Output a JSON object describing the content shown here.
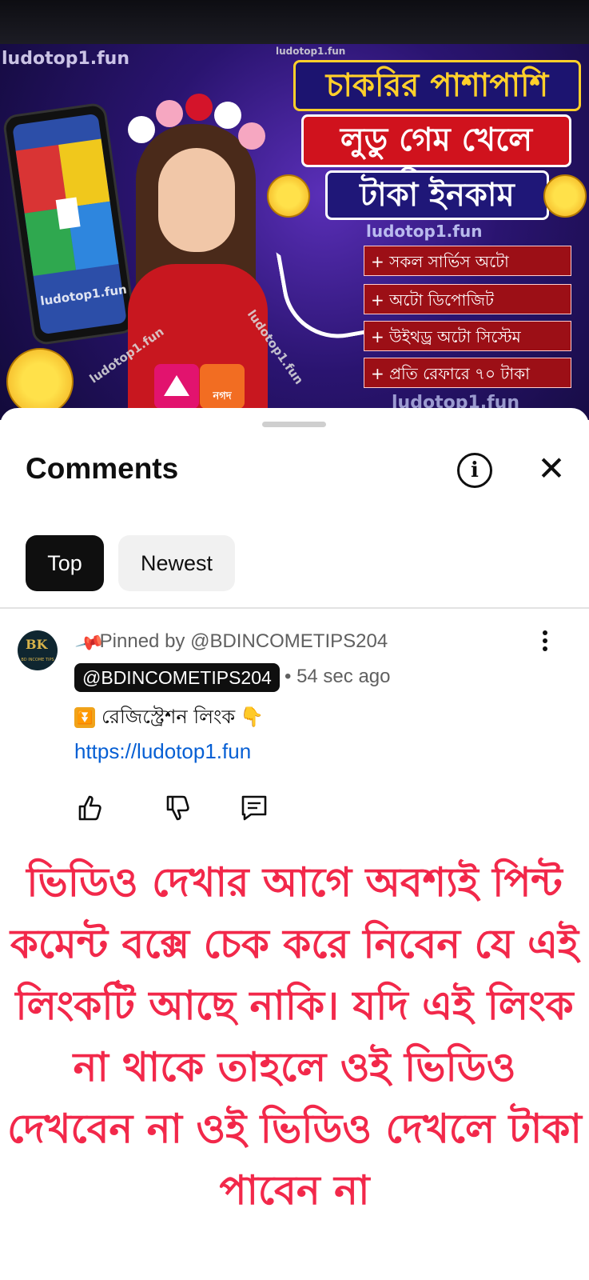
{
  "video": {
    "watermark": "ludotop1.fun",
    "watermark_small": "ludotop1.fun",
    "headline_line1": "চাকরির পাশাপাশি",
    "headline_line2": "লুডু গেম খেলে ফ্রিতে",
    "headline_line3": "টাকা ইনকাম",
    "features": [
      "+ সকল সার্ভিস অটো",
      "+ অটো ডিপোজিট",
      "+ উইথড্র অটো সিস্টেম",
      "+ প্রতি রেফারে ৭০ টাকা"
    ],
    "payment_logo_text": "নগদ"
  },
  "comments_panel": {
    "title": "Comments",
    "info_icon": "info-circle-icon",
    "close_icon": "close-icon",
    "filters": [
      {
        "label": "Top",
        "selected": true
      },
      {
        "label": "Newest",
        "selected": false
      }
    ]
  },
  "pinned_comment": {
    "avatar_text": "BK",
    "avatar_subtext": "BD INCOME TIPS",
    "pinned_label": "Pinned by @BDINCOMETIPS204",
    "author": "@BDINCOMETIPS204",
    "time": "• 54 sec ago",
    "text": "রেজিস্ট্রেশন লিংক",
    "link": "https://ludotop1.fun",
    "actions": [
      "like-icon",
      "dislike-icon",
      "reply-icon"
    ]
  },
  "warning_text": "ভিডিও দেখার আগে অবশ্যই পিন্ট কমেন্ট বক্সে চেক করে নিবেন যে এই লিংকটি আছে নাকি। যদি এই লিংক না থাকে তাহলে ওই ভিডিও দেখবেন না ওই ভিডিও দেখলে টাকা পাবেন না",
  "colors": {
    "warning": "#f2284a",
    "link": "#065fd4",
    "chip_selected": "#0f0f0f",
    "chip_unselected": "#f1f1f1"
  }
}
